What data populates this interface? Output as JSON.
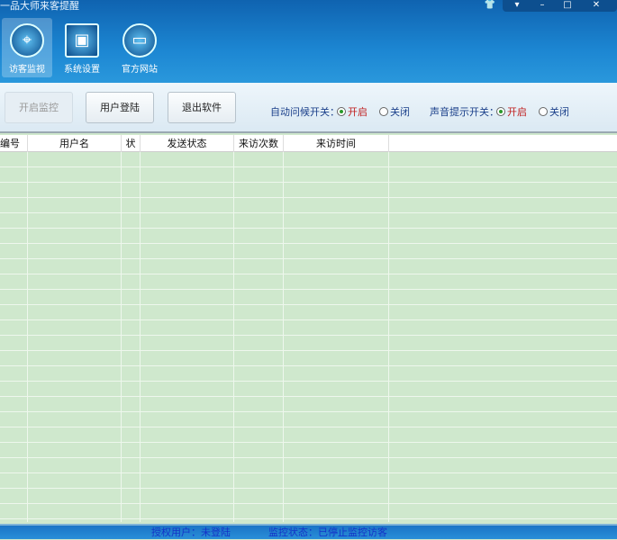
{
  "window": {
    "title": "一品大师来客提醒",
    "controls": [
      "skin-icon",
      "menu-icon",
      "minimize-icon",
      "maximize-icon",
      "close-icon"
    ]
  },
  "nav": [
    {
      "label": "访客监视",
      "icon": "shield-target-icon",
      "active": true
    },
    {
      "label": "系统设置",
      "icon": "monitor-stethoscope-icon",
      "active": false
    },
    {
      "label": "官方网站",
      "icon": "globe-monitor-icon",
      "active": false
    }
  ],
  "toolbar": {
    "start": "开启监控",
    "login": "用户登陆",
    "exit": "退出软件",
    "auto_greet": {
      "label": "自动问候开关：",
      "on": "开启",
      "off": "关闭",
      "selected": "开启"
    },
    "sound": {
      "label": "声音提示开关：",
      "on": "开启",
      "off": "关闭",
      "selected": "开启"
    }
  },
  "table": {
    "columns": [
      "编号",
      "用户名",
      "状",
      "发送状态",
      "来访次数",
      "来访时间"
    ],
    "rows": []
  },
  "status": {
    "user": "授权用户：未登陆",
    "monitor": "监控状态：已停止监控访客"
  },
  "colors": {
    "accent": "#1c86d2",
    "grid": "#cfe8cd",
    "on": "#c02020"
  }
}
